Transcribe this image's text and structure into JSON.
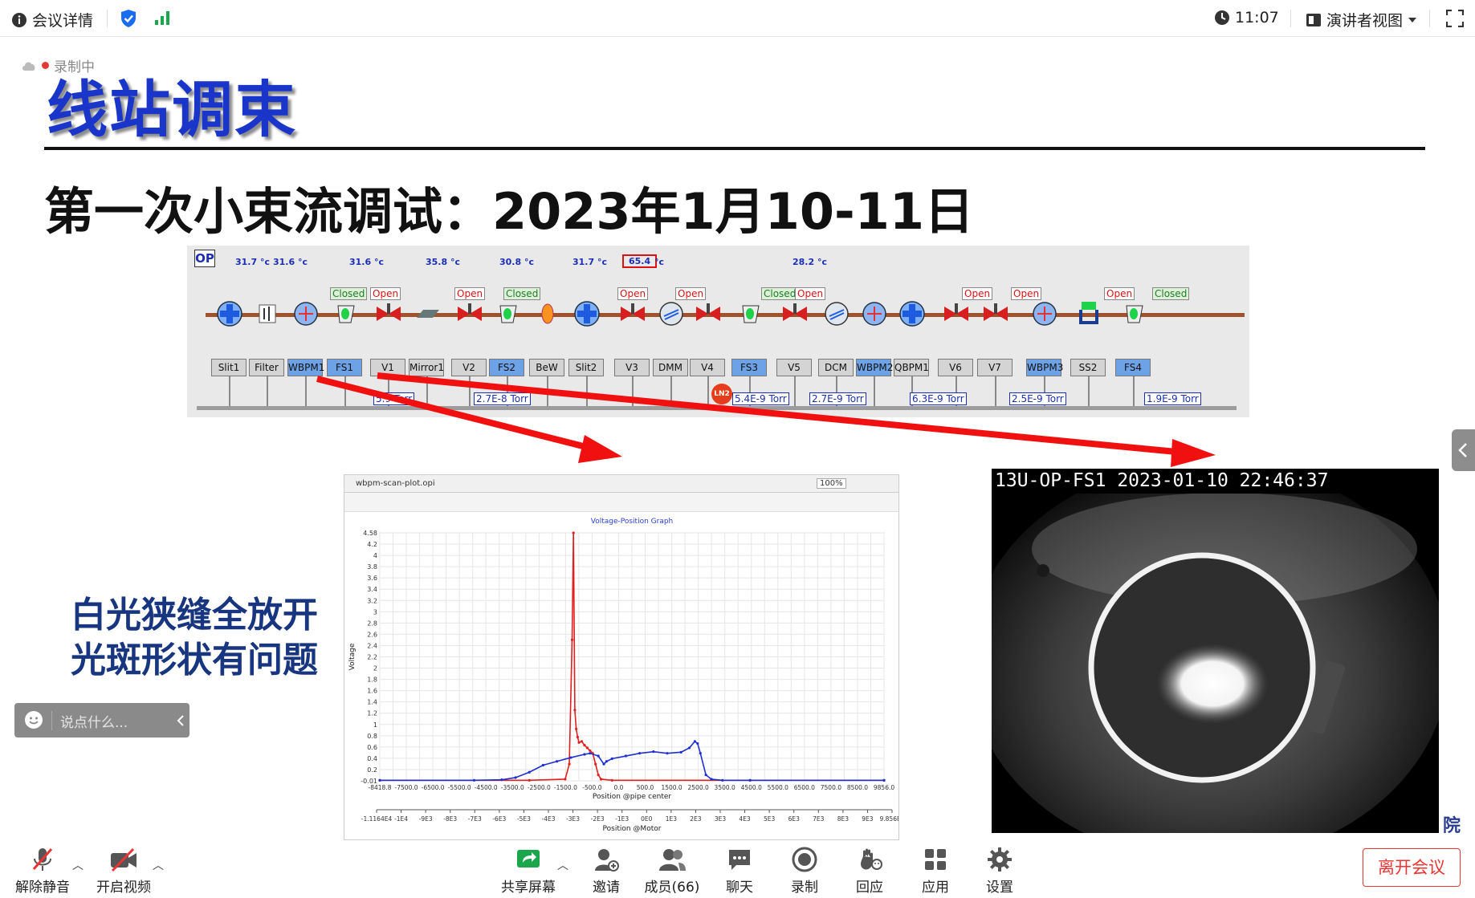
{
  "topbar": {
    "meeting_details": "会议详情",
    "time": "11:07",
    "view_mode": "演讲者视图"
  },
  "slide": {
    "recording_badge": "录制中",
    "title": "线站调束",
    "subtitle": "第一次小束流调试：2023年1月10-11日",
    "note_line1": "白光狭缝全放开",
    "note_line2": "光斑形状有问题",
    "synoptic": {
      "op_label": "OP",
      "temperatures": [
        "31.7 °c",
        "31.6 °c",
        "31.6 °c",
        "35.8 °c",
        "30.8 °c",
        "31.7 °c",
        "65.4",
        "°c",
        "28.2 °c"
      ],
      "status_tags": [
        "Closed",
        "Open",
        "Open",
        "Closed",
        "Open",
        "Open",
        "Closed",
        "Open",
        "Open",
        "Open",
        "Open",
        "Closed"
      ],
      "devices": [
        "Slit1",
        "Filter",
        "WBPM1",
        "FS1",
        "V1",
        "Mirror1",
        "V2",
        "FS2",
        "BeW",
        "Slit2",
        "V3",
        "DMM",
        "V4",
        "FS3",
        "V5",
        "DCM",
        "WBPM2",
        "QBPM1",
        "V6",
        "V7",
        "WBPM3",
        "SS2",
        "FS4"
      ],
      "pressures": [
        "5.9 Torr",
        "2.7E-8 Torr",
        "5.4E-9 Torr",
        "2.7E-9 Torr",
        "6.3E-9 Torr",
        "2.5E-9 Torr",
        "1.9E-9 Torr"
      ],
      "ln2": "LN2"
    },
    "plot_window": {
      "tab": "wbpm-scan-plot.opi",
      "zoom": "100%"
    },
    "camera": {
      "caption": "13U-OP-FS1  2023-01-10  22:46:37",
      "corner_text": "院"
    }
  },
  "chart_data": {
    "type": "scatter",
    "title": "Voltage-Position Graph",
    "xlabel": "Position @pipe center",
    "xlabel2": "Position @Motor",
    "ylabel": "Voltage",
    "xlim": [
      -8418.8,
      9856.0
    ],
    "ylim": [
      -0.01,
      4.58
    ],
    "yticks": [
      "4.58",
      "4.2",
      "4",
      "3.8",
      "3.6",
      "3.4",
      "3.2",
      "3",
      "2.8",
      "2.6",
      "2.4",
      "2.2",
      "2",
      "1.8",
      "1.6",
      "1.4",
      "1.2",
      "1",
      "0.8",
      "0.6",
      "0.4",
      "0.2",
      "-0.01"
    ],
    "xticks": [
      "-8418.8",
      "-7500.0",
      "-6500.0",
      "-5500.0",
      "-4500.0",
      "-3500.0",
      "-2500.0",
      "-1500.0",
      "-500.0",
      "0.0",
      "500.0",
      "1500.0",
      "2500.0",
      "3500.0",
      "4500.0",
      "5500.0",
      "6500.0",
      "7500.0",
      "8500.0",
      "9856.0"
    ],
    "xticks2": [
      "-1.1164E4",
      "-1E4",
      "-9E3",
      "-8E3",
      "-7E3",
      "-6E3",
      "-5E3",
      "-4E3",
      "-3E3",
      "-2E3",
      "-1E3",
      "0E0",
      "1E3",
      "2E3",
      "3E3",
      "4E3",
      "5E3",
      "6E3",
      "7E3",
      "8E3",
      "9E3",
      "9.856E3"
    ],
    "series": [
      {
        "name": "",
        "color": "#e02020",
        "x": [
          -8418.8,
          -3000,
          -1700,
          -1550,
          -1450,
          -1400,
          -1350,
          -1300,
          -1250,
          -1200,
          -1100,
          -1000,
          -900,
          -800,
          -700,
          -600,
          -500,
          -400,
          0,
          5000,
          9856
        ],
        "y": [
          0,
          0,
          0.02,
          0.3,
          2.6,
          4.58,
          1.3,
          0.95,
          0.8,
          0.7,
          0.72,
          0.65,
          0.6,
          0.55,
          0.5,
          0.3,
          0.1,
          0.02,
          0,
          0,
          0
        ]
      },
      {
        "name": "",
        "color": "#1e2fd0",
        "x": [
          -8418.8,
          -5000,
          -4000,
          -3500,
          -3000,
          -2500,
          -2000,
          -1500,
          -1000,
          -800,
          -500,
          -300,
          -200,
          0,
          500,
          1000,
          1500,
          2000,
          2500,
          2800,
          3000,
          3100,
          3200,
          3400,
          3600,
          4000,
          5000,
          9856
        ],
        "y": [
          0,
          0,
          0.01,
          0.05,
          0.15,
          0.28,
          0.35,
          0.42,
          0.48,
          0.5,
          0.45,
          0.3,
          0.35,
          0.4,
          0.45,
          0.5,
          0.53,
          0.5,
          0.52,
          0.6,
          0.72,
          0.68,
          0.5,
          0.1,
          0.02,
          0,
          0,
          0
        ]
      }
    ]
  },
  "chat": {
    "placeholder": "说点什么..."
  },
  "bottombar": {
    "unmute": "解除静音",
    "video": "开启视频",
    "share": "共享屏幕",
    "invite": "邀请",
    "members": "成员(66)",
    "chat": "聊天",
    "record": "录制",
    "react": "回应",
    "apps": "应用",
    "settings": "设置",
    "leave": "离开会议"
  },
  "colors": {
    "accent": "#1a35c9",
    "danger": "#e33333",
    "share_green": "#1aa64b"
  }
}
